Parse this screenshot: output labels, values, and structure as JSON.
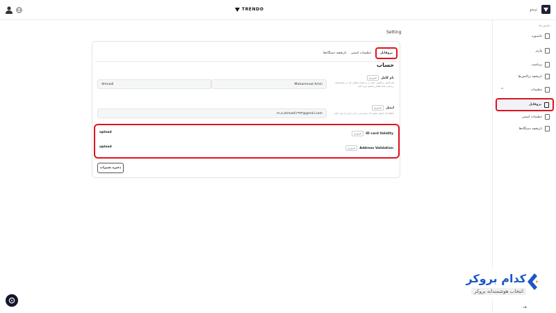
{
  "header": {
    "logo_text": "TRENDO",
    "brand_name": "ترندو"
  },
  "sidebar": {
    "caption": "داشبوردها",
    "items": [
      {
        "label": "داشبورد"
      },
      {
        "label": "واریز"
      },
      {
        "label": "برداشت"
      },
      {
        "label": "تاریخچه تراکنش‌ها"
      },
      {
        "label": "تنظیمات"
      },
      {
        "label": "پروفایل"
      },
      {
        "label": "تنظیمات امنیتی"
      },
      {
        "label": "تاریخچه دستگاه‌ها"
      }
    ]
  },
  "page": {
    "title": "Setting"
  },
  "tabs": [
    {
      "label": "پروفایل"
    },
    {
      "label": "تنظیمات امنیتی"
    },
    {
      "label": "تاریخچه دستگاه‌ها"
    }
  ],
  "account": {
    "section_title": "حساب",
    "required_badge": "ضروری",
    "name": {
      "label": "نام کامل",
      "help": "نام کامل و قانونی خود را به همان شکلی که در شناسنامه رسمی شما ظاهر میشود وارد کنید.",
      "first_name": "Mohammad Amin",
      "last_name": "Ahmadi"
    },
    "email": {
      "label": "ایمیل",
      "help": "لطفا یک ایمیل معتبر که دسترسی به آن دارید را وارد کنید.",
      "value": "m.a.ahmadi۱۳۷۳@gmail.com"
    },
    "uploads": [
      {
        "label": "ID card Validity",
        "button": "upload"
      },
      {
        "label": "Address Validation",
        "button": "upload"
      }
    ],
    "save_label": "ذخیره تغییرات"
  },
  "watermark": {
    "title": "کدام بروکر",
    "subtitle": "انتخاب هوشمندانه بروکر",
    "brand_color": "#1b55c9"
  },
  "colors": {
    "highlight": "#e0121c",
    "dark": "#14162a"
  },
  "icons": [
    "user-icon",
    "globe-icon",
    "dashboard-icon",
    "chat-icon",
    "arrow-icon"
  ]
}
